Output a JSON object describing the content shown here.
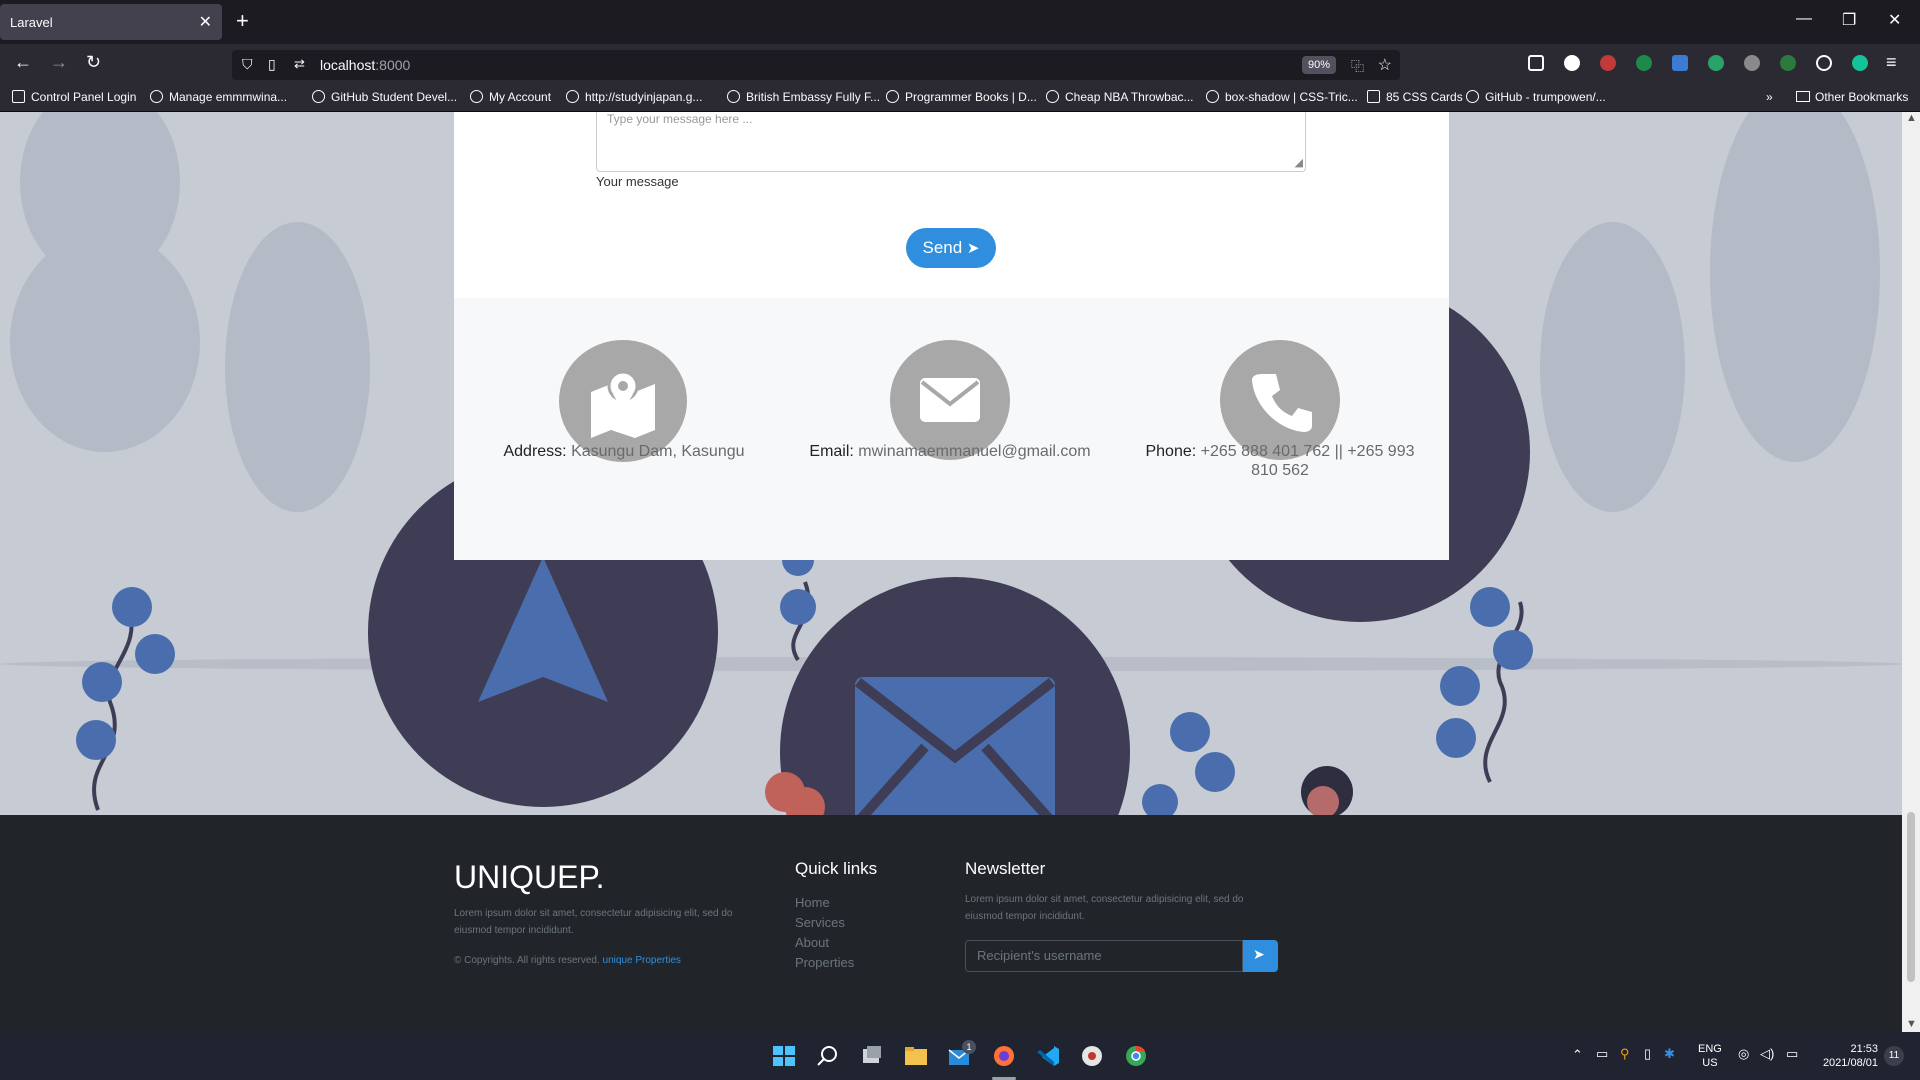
{
  "browser": {
    "tab_title": "Laravel",
    "url_host": "localhost",
    "url_port": ":8000",
    "zoom": "90%",
    "bookmarks": [
      "Control Panel Login",
      "Manage emmmwina...",
      "GitHub Student Devel...",
      "My Account",
      "http://studyinjapan.g...",
      "British Embassy Fully F...",
      "Programmer Books | D...",
      "Cheap NBA Throwbac...",
      "box-shadow | CSS-Tric...",
      "85 CSS Cards",
      "GitHub - trumpowen/..."
    ],
    "other_bookmarks": "Other Bookmarks"
  },
  "contact": {
    "message_placeholder": "Type your message here ...",
    "message_label": "Your message",
    "send_label": "Send",
    "address_label": "Address:",
    "address_value": "Kasungu Dam, Kasungu",
    "email_label": "Email:",
    "email_value": "mwinamaemmanuel@gmail.com",
    "phone_label": "Phone:",
    "phone_value_line1": "+265 888 401 762 || +265 993",
    "phone_value_line2": "810 562"
  },
  "footer": {
    "brand": "UNIQUEP.",
    "description_line1": "Lorem ipsum dolor sit amet, consectetur adipisicing elit, sed do",
    "description_line2": "eiusmod tempor incididunt.",
    "copyright": "© Copyrights. All rights reserved.",
    "copyright_link": "unique Properties",
    "quick_links_title": "Quick links",
    "quick_links": [
      "Home",
      "Services",
      "About",
      "Properties"
    ],
    "newsletter_title": "Newsletter",
    "newsletter_text_line1": "Lorem ipsum dolor sit amet, consectetur adipisicing elit, sed do",
    "newsletter_text_line2": "eiusmod tempor incididunt.",
    "newsletter_placeholder": "Recipient's username"
  },
  "taskbar": {
    "lang_line1": "ENG",
    "lang_line2": "US",
    "time": "21:53",
    "date": "2021/08/01",
    "notification_count": "11",
    "mail_badge": "1"
  },
  "colors": {
    "accent": "#2f8fde",
    "footer_bg": "#212529",
    "page_bg": "#c7cbd3"
  }
}
